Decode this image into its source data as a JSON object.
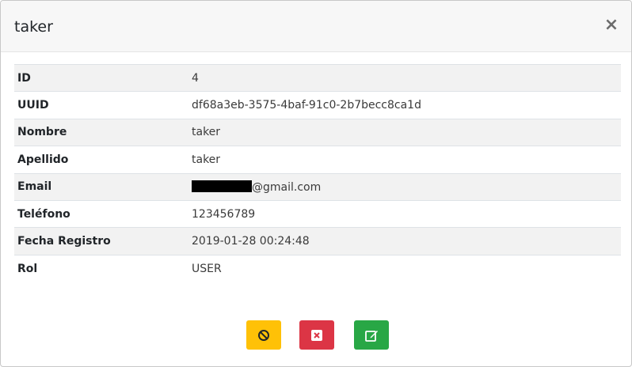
{
  "modal": {
    "title": "taker",
    "close_glyph": "×"
  },
  "details": [
    {
      "label": "ID",
      "value": "4"
    },
    {
      "label": "UUID",
      "value": "df68a3eb-3575-4baf-91c0-2b7becc8ca1d"
    },
    {
      "label": "Nombre",
      "value": "taker"
    },
    {
      "label": "Apellido",
      "value": "taker"
    },
    {
      "label": "Email",
      "value": "@gmail.com"
    },
    {
      "label": "Teléfono",
      "value": "123456789"
    },
    {
      "label": "Fecha Registro",
      "value": "2019-01-28 00:24:48"
    },
    {
      "label": "Rol",
      "value": "USER"
    }
  ],
  "actions": {
    "block": {
      "icon": "ban-icon",
      "color": "#ffc107"
    },
    "delete": {
      "icon": "close-square-icon",
      "color": "#dc3545"
    },
    "edit": {
      "icon": "edit-icon",
      "color": "#28a745"
    }
  }
}
